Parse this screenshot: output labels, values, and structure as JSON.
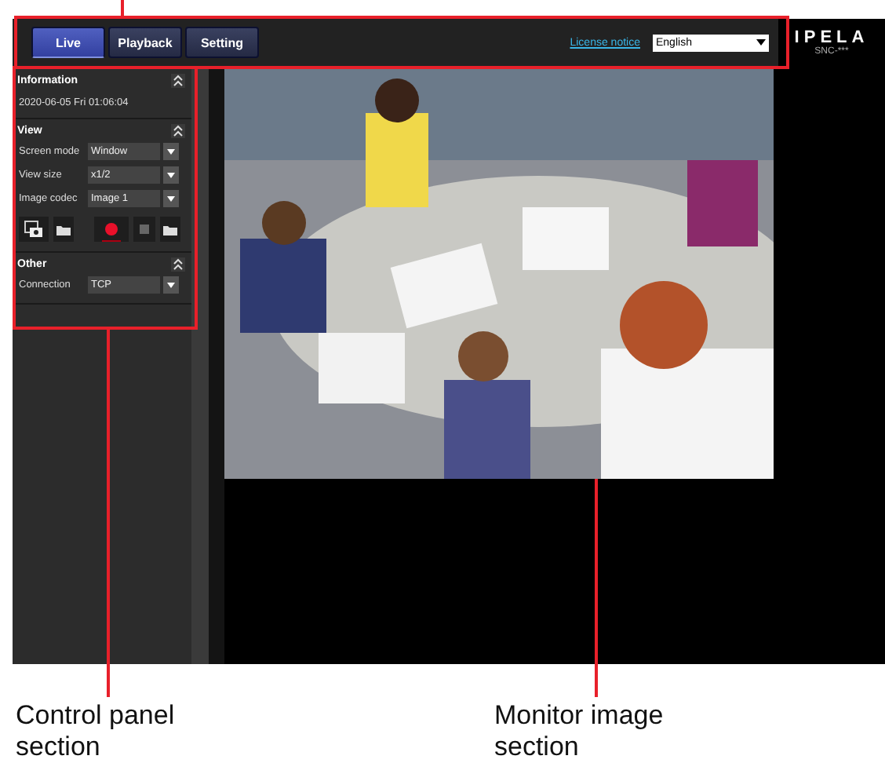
{
  "header": {
    "tabs": [
      {
        "label": "Live",
        "selected": true
      },
      {
        "label": "Playback",
        "selected": false
      },
      {
        "label": "Setting",
        "selected": false
      }
    ],
    "license_link": "License notice",
    "language": "English",
    "logo": "IPELA",
    "model": "SNC-***"
  },
  "control_panel": {
    "sections": [
      {
        "kind": "info",
        "title": "Information",
        "expanded": true,
        "text": "2020-06-05 Fri 01:06:04"
      },
      {
        "kind": "view",
        "title": "View",
        "expanded": true,
        "fields": [
          {
            "label": "Screen mode",
            "value": "Window"
          },
          {
            "label": "View size",
            "value": "x1/2"
          },
          {
            "label": "Image codec",
            "value": "Image 1"
          }
        ]
      },
      {
        "kind": "other",
        "title": "Other",
        "expanded": true,
        "fields": [
          {
            "label": "Connection",
            "value": "TCP"
          }
        ]
      }
    ]
  },
  "callouts": [
    {
      "label": "Control panel section"
    },
    {
      "label": "Monitor image section"
    }
  ]
}
